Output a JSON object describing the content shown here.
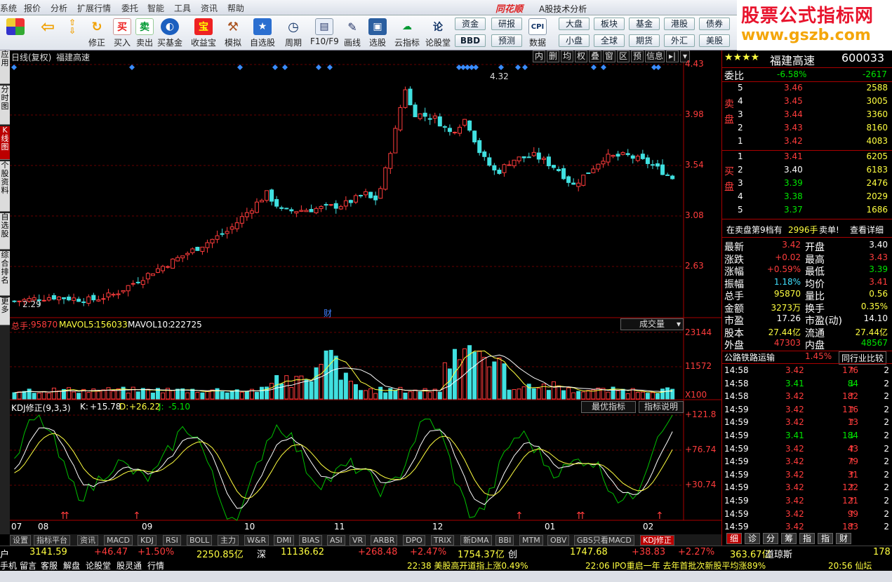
{
  "menu": {
    "items": [
      "系统",
      "报价",
      "分析",
      "扩展行情",
      "委托",
      "智能",
      "工具",
      "资讯",
      "帮助"
    ],
    "brand": "同花顺",
    "brand_sub": "A股技术分析"
  },
  "toolbar": {
    "buttons": [
      "修正",
      "买入",
      "卖出",
      "买基金",
      "收益宝",
      "模拟",
      "自选股",
      "周期",
      "F10/F9",
      "画线",
      "选股",
      "云指标",
      "论股堂",
      "数据"
    ],
    "pills": [
      "资金",
      "研报",
      "BBD",
      "预测",
      "大盘",
      "板块",
      "小盘",
      "全球",
      "基金",
      "期货",
      "港股",
      "外汇",
      "债券",
      "美股"
    ]
  },
  "watermark": {
    "line1": "股票公式指标网",
    "line2": "www.gszb.com"
  },
  "sidetabs": [
    "应用",
    "分时图",
    "K线图",
    "个股资料",
    "自选股",
    "综合排名",
    "更多"
  ],
  "chart": {
    "title": "日线(复权)",
    "stock": "福建高速",
    "price_axis": [
      "4.43",
      "3.98",
      "3.54",
      "3.08",
      "2.63"
    ],
    "high_label": "4.32",
    "low_label": "2.29",
    "fin_mark": "财",
    "tools": [
      "内",
      "删",
      "均",
      "权",
      "叠",
      "窗",
      "区",
      "预",
      "信息"
    ],
    "vol": {
      "label_total": "总手:",
      "total": "95870",
      "ma5_label": "MAVOL5:",
      "ma5": "156033",
      "ma10_label": "MAVOL10:",
      "ma10": "222725",
      "selector": "成交量",
      "axis": [
        "23144",
        "11572",
        "X100"
      ]
    },
    "kdj": {
      "name": "KDJ修正(9,3,3)",
      "k_label": "K:",
      "k": "+15.78",
      "d_label": "D:",
      "d": "+26.22",
      "j_label": "J:",
      "j": "-5.10",
      "btn1": "最优指标",
      "btn2": "指标说明",
      "axis": [
        "+121.8",
        "+76.74",
        "+30.74"
      ]
    },
    "months": [
      "07",
      "08",
      "09",
      "10",
      "11",
      "12",
      "01",
      "02"
    ]
  },
  "bottom_tabs": [
    "设置",
    "指标平台",
    "资讯",
    "MACD",
    "KDJ",
    "RSI",
    "BOLL",
    "主力",
    "W&R",
    "DMI",
    "BIAS",
    "ASI",
    "VR",
    "ARBR",
    "DPO",
    "TRIX",
    "新DMA",
    "BBI",
    "MTM",
    "OBV",
    "GBS只看MACD",
    "KDJ修正"
  ],
  "quote": {
    "stars": "★★★★",
    "name": "福建高速",
    "code": "600033",
    "wb_label": "委比",
    "wb_pct": "-6.58%",
    "wb_val": "-2617",
    "sell_label": "卖盘",
    "buy_label": "买盘",
    "sell": [
      {
        "n": "5",
        "p": "3.46",
        "v": "2588"
      },
      {
        "n": "4",
        "p": "3.45",
        "v": "3005"
      },
      {
        "n": "3",
        "p": "3.44",
        "v": "3360"
      },
      {
        "n": "2",
        "p": "3.43",
        "v": "8160"
      },
      {
        "n": "1",
        "p": "3.42",
        "v": "4083"
      }
    ],
    "buy": [
      {
        "n": "1",
        "p": "3.41",
        "v": "6205"
      },
      {
        "n": "2",
        "p": "3.40",
        "v": "6183"
      },
      {
        "n": "3",
        "p": "3.39",
        "v": "2476"
      },
      {
        "n": "4",
        "p": "3.38",
        "v": "2029"
      },
      {
        "n": "5",
        "p": "3.37",
        "v": "1686"
      }
    ],
    "notice": "在卖盘第9档有",
    "notice_vol": "2996手",
    "notice_act": "卖单!",
    "notice_link": "查看详细",
    "stats": [
      [
        "最新",
        "3.42",
        "开盘",
        "3.40"
      ],
      [
        "涨跌",
        "+0.02",
        "最高",
        "3.43"
      ],
      [
        "涨幅",
        "+0.59%",
        "最低",
        "3.39"
      ],
      [
        "振幅",
        "1.18%",
        "均价",
        "3.41"
      ],
      [
        "总手",
        "95870",
        "量比",
        "0.56"
      ],
      [
        "金额",
        "3273万",
        "换手",
        "0.35%"
      ],
      [
        "市盈",
        "17.26",
        "市盈(动)",
        "14.10"
      ],
      [
        "股本",
        "27.44亿",
        "流通",
        "27.44亿"
      ],
      [
        "外盘",
        "47303",
        "内盘",
        "48567"
      ]
    ],
    "industry": "公路铁路运输",
    "industry_pct": "1.45%",
    "industry_btn": "同行业比较",
    "ticks": [
      [
        "14:58",
        "3.42",
        "176",
        "↑",
        "2"
      ],
      [
        "14:58",
        "3.41",
        "84",
        "↓",
        "2"
      ],
      [
        "14:58",
        "3.42",
        "182",
        "↑",
        "2"
      ],
      [
        "14:59",
        "3.42",
        "116",
        "↑",
        "2"
      ],
      [
        "14:59",
        "3.42",
        "13",
        "↑",
        "2"
      ],
      [
        "14:59",
        "3.41",
        "184",
        "↓",
        "2"
      ],
      [
        "14:59",
        "3.42",
        "43",
        "↑",
        "2"
      ],
      [
        "14:59",
        "3.42",
        "79",
        "↑",
        "2"
      ],
      [
        "14:59",
        "3.42",
        "31",
        "↑",
        "2"
      ],
      [
        "14:59",
        "3.42",
        "122",
        "↑",
        "2"
      ],
      [
        "14:59",
        "3.42",
        "121",
        "↑",
        "2"
      ],
      [
        "14:59",
        "3.42",
        "99",
        "↑",
        "2"
      ],
      [
        "14:59",
        "3.42",
        "183",
        "↑",
        "2"
      ]
    ],
    "tabs": [
      "细",
      "诊",
      "分",
      "筹",
      "指",
      "指",
      "财"
    ]
  },
  "status1": [
    "户",
    "3141.59",
    "+46.47",
    "+1.50%",
    "2250.85亿",
    "深",
    "11136.62",
    "+268.48",
    "+2.47%",
    "1754.37亿",
    "创",
    "1747.68",
    "+38.83",
    "+2.27%",
    "363.67亿",
    "道琼斯",
    "178"
  ],
  "status2": {
    "items": [
      "手机",
      "留言",
      "客服",
      "解盘",
      "论股堂",
      "股灵通",
      "行情"
    ],
    "news1": "22:38 美股高开道指上涨0.49%",
    "news2": "22:06 IPO重启一年 去年首批次新股平均涨89%",
    "news3": "20:56 仙坛"
  }
}
